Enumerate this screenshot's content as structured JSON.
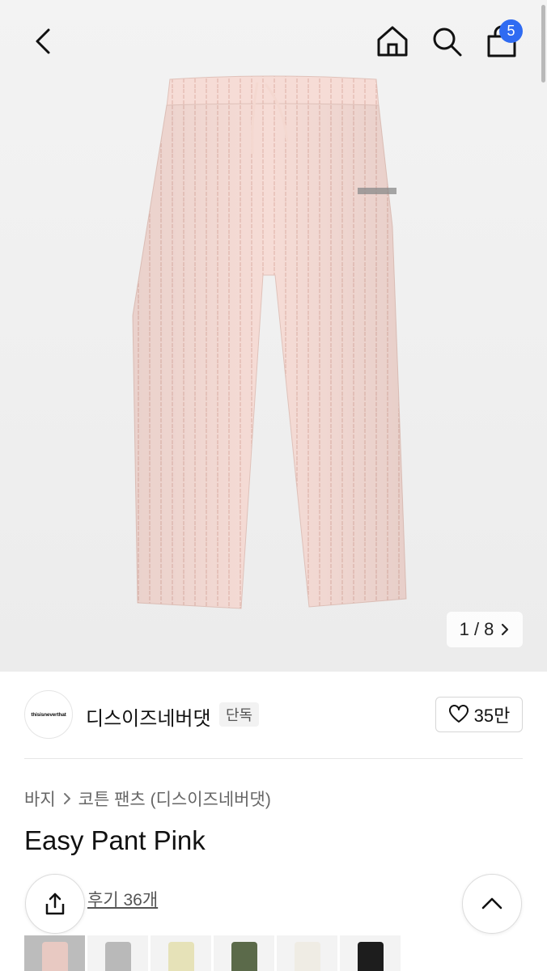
{
  "header": {
    "icons": [
      "back-icon",
      "home-icon",
      "search-icon",
      "cart-icon"
    ],
    "cart_count": "5",
    "accent": "#2f6bf2"
  },
  "gallery": {
    "pager": "1 / 8"
  },
  "brand": {
    "logo_text": "thisisneverthat",
    "name": "디스이즈네버댓",
    "tag": "단독",
    "likes": "35만"
  },
  "breadcrumb": {
    "category": "바지",
    "subcategory": "코튼 팬츠 (디스이즈네버댓)"
  },
  "product": {
    "title": "Easy Pant Pink",
    "reviews": "후기 36개"
  },
  "color_options": {
    "swatches": [
      "#e8c9c2",
      "#b9b9b9",
      "#e6e2b8",
      "#5b6a4a",
      "#efece4",
      "#1d1d1d"
    ]
  }
}
